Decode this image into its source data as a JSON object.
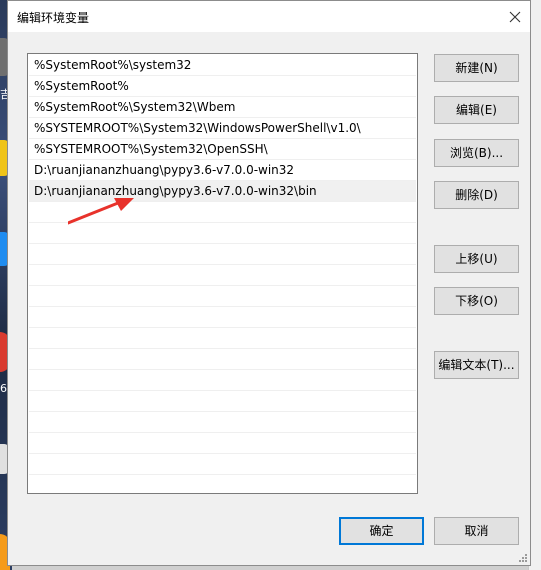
{
  "dialog": {
    "title": "编辑环境变量"
  },
  "path_list": {
    "items": [
      "%SystemRoot%\\system32",
      "%SystemRoot%",
      "%SystemRoot%\\System32\\Wbem",
      "%SYSTEMROOT%\\System32\\WindowsPowerShell\\v1.0\\",
      "%SYSTEMROOT%\\System32\\OpenSSH\\",
      "D:\\ruanjiananzhuang\\pypy3.6-v7.0.0-win32",
      "D:\\ruanjiananzhuang\\pypy3.6-v7.0.0-win32\\bin"
    ],
    "selected_index": 6
  },
  "buttons": {
    "new": "新建(N)",
    "edit": "编辑(E)",
    "browse": "浏览(B)...",
    "delete": "删除(D)",
    "move_up": "上移(U)",
    "move_down": "下移(O)",
    "edit_text": "编辑文本(T)...",
    "ok": "确定",
    "cancel": "取消"
  },
  "background": {
    "left_glyphs": [
      "吉",
      "6"
    ]
  },
  "colors": {
    "arrow": "#e8322b",
    "default_button_border": "#0078d7"
  }
}
